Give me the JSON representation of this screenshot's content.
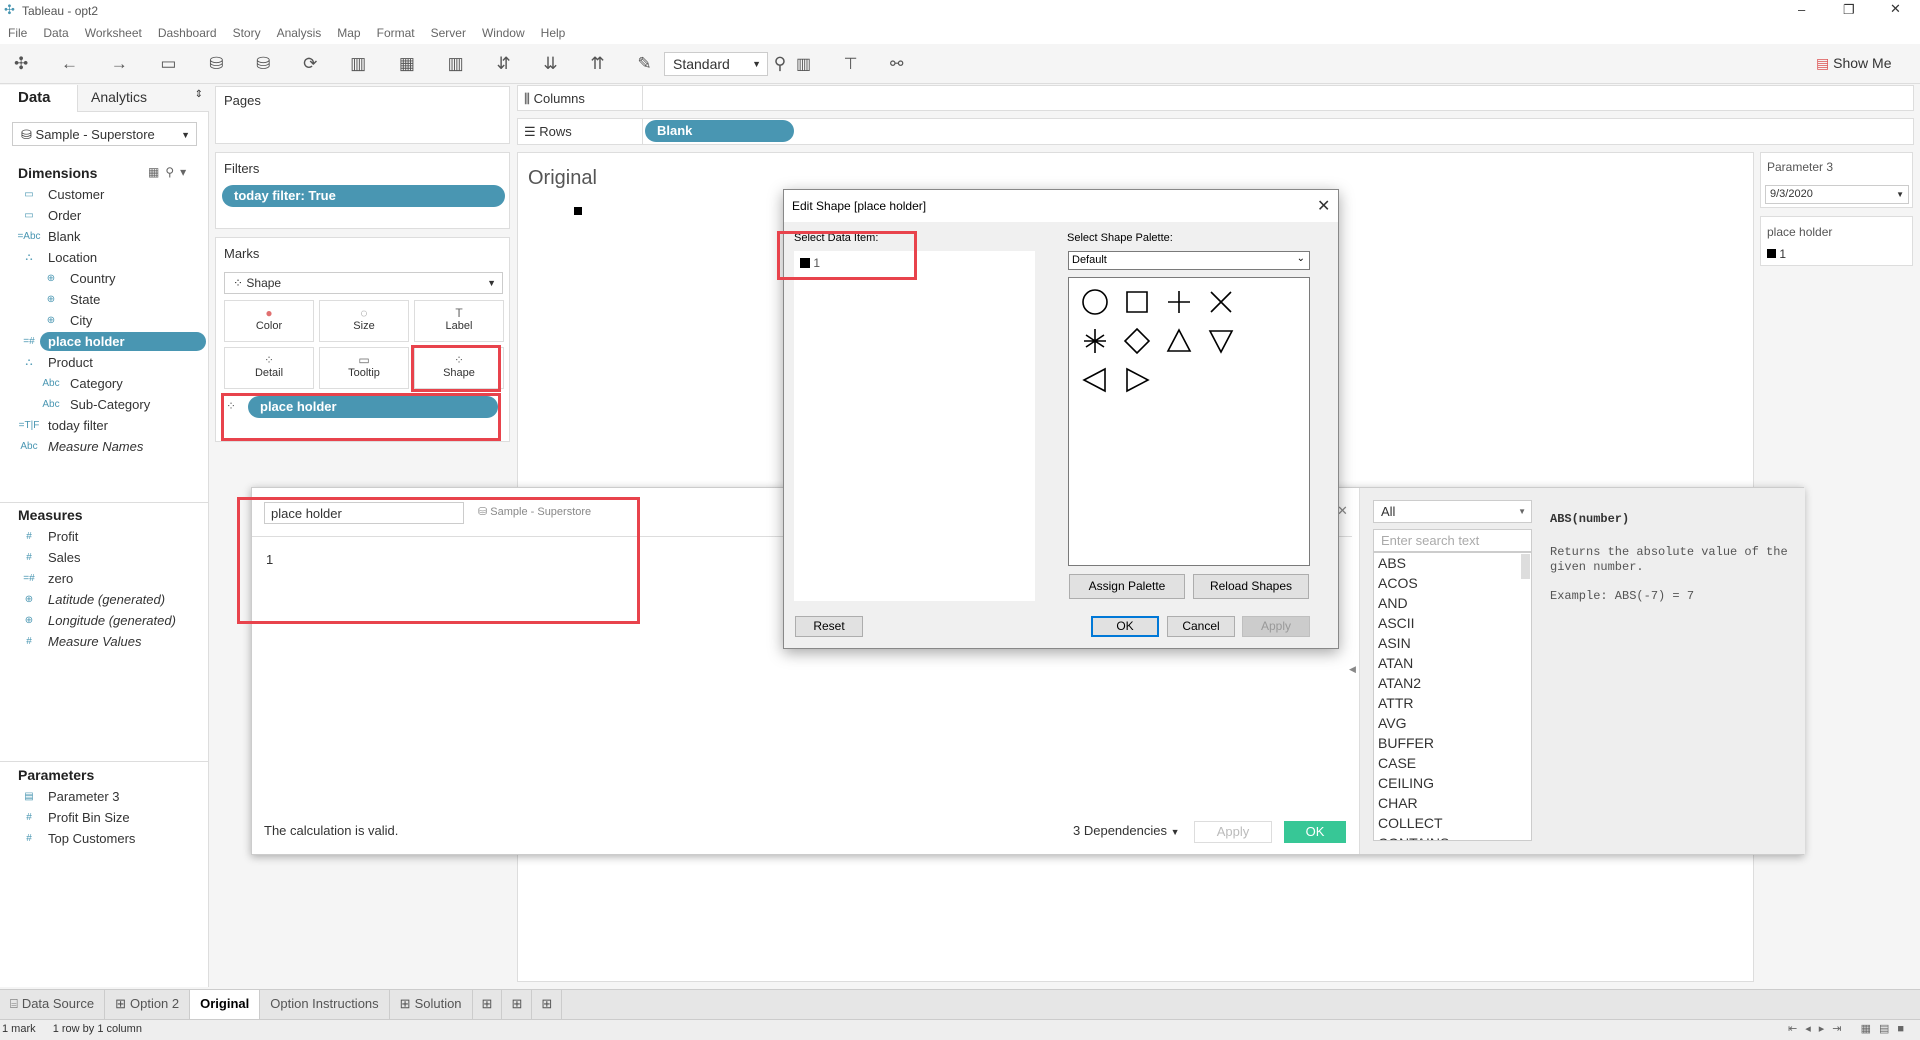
{
  "window": {
    "title": "Tableau - opt2"
  },
  "menu": [
    "File",
    "Data",
    "Worksheet",
    "Dashboard",
    "Story",
    "Analysis",
    "Map",
    "Format",
    "Server",
    "Window",
    "Help"
  ],
  "toolbar": {
    "fit": "Standard",
    "show_me": "Show Me"
  },
  "left": {
    "tabs": [
      "Data",
      "Analytics"
    ],
    "datasource": "Sample - Superstore",
    "dimensions_label": "Dimensions",
    "dimensions": [
      {
        "t": "Customer",
        "i": "▭",
        "l": 0
      },
      {
        "t": "Order",
        "i": "▭",
        "l": 0
      },
      {
        "t": "Blank",
        "i": "=Abc",
        "l": 0
      },
      {
        "t": "Location",
        "i": "⛬",
        "l": 0
      },
      {
        "t": "Country",
        "i": "⊕",
        "l": 1
      },
      {
        "t": "State",
        "i": "⊕",
        "l": 1
      },
      {
        "t": "City",
        "i": "⊕",
        "l": 1
      },
      {
        "t": "place holder",
        "i": "=#",
        "l": 0,
        "sel": true
      },
      {
        "t": "Product",
        "i": "⛬",
        "l": 0
      },
      {
        "t": "Category",
        "i": "Abc",
        "l": 1
      },
      {
        "t": "Sub-Category",
        "i": "Abc",
        "l": 1
      },
      {
        "t": "today filter",
        "i": "=T|F",
        "l": 0
      },
      {
        "t": "Measure Names",
        "i": "Abc",
        "l": 0,
        "it": true
      }
    ],
    "measures_label": "Measures",
    "measures": [
      {
        "t": "Profit",
        "i": "#"
      },
      {
        "t": "Sales",
        "i": "#"
      },
      {
        "t": "zero",
        "i": "=#"
      },
      {
        "t": "Latitude (generated)",
        "i": "⊕",
        "it": true
      },
      {
        "t": "Longitude (generated)",
        "i": "⊕",
        "it": true
      },
      {
        "t": "Measure Values",
        "i": "#",
        "it": true
      }
    ],
    "parameters_label": "Parameters",
    "parameters": [
      {
        "t": "Parameter 3",
        "i": "▤"
      },
      {
        "t": "Profit Bin Size",
        "i": "#"
      },
      {
        "t": "Top Customers",
        "i": "#"
      }
    ]
  },
  "shelves": {
    "pages": "Pages",
    "filters": "Filters",
    "filter_pill": "today filter: True",
    "marks": "Marks",
    "mark_type": "Shape",
    "mark_buttons": [
      "Color",
      "Size",
      "Label",
      "Detail",
      "Tooltip",
      "Shape"
    ],
    "marks_pill": "place holder",
    "columns": "Columns",
    "rows": "Rows",
    "rows_pill": "Blank"
  },
  "view": {
    "title": "Original"
  },
  "cards": {
    "param_title": "Parameter 3",
    "param_value": "9/3/2020",
    "legend_title": "place holder",
    "legend_item": "1"
  },
  "calc": {
    "name": "place holder",
    "datasource": "Sample - Superstore",
    "formula": "1",
    "status": "The calculation is valid.",
    "dependencies": "3 Dependencies",
    "apply": "Apply",
    "ok": "OK",
    "func_filter": "All",
    "search_placeholder": "Enter search text",
    "functions": [
      "ABS",
      "ACOS",
      "AND",
      "ASCII",
      "ASIN",
      "ATAN",
      "ATAN2",
      "ATTR",
      "AVG",
      "BUFFER",
      "CASE",
      "CEILING",
      "CHAR",
      "COLLECT",
      "CONTAINS"
    ],
    "help_sig": "ABS(number)",
    "help_desc": "Returns the absolute value of the given number.",
    "help_example": "Example: ABS(-7) = 7"
  },
  "dialog": {
    "title": "Edit Shape [place holder]",
    "select_item": "Select Data Item:",
    "item": "1",
    "select_palette": "Select Shape Palette:",
    "palette": "Default",
    "shapes": [
      "circle",
      "square",
      "plus",
      "cross",
      "asterisk",
      "diamond",
      "triangle-up",
      "triangle-down",
      "triangle-left",
      "triangle-right"
    ],
    "assign": "Assign Palette",
    "reload": "Reload Shapes",
    "reset": "Reset",
    "ok": "OK",
    "cancel": "Cancel",
    "apply": "Apply"
  },
  "tabs": [
    {
      "t": "Data Source",
      "i": "⌸"
    },
    {
      "t": "Option 2",
      "i": "⊞"
    },
    {
      "t": "Original",
      "active": true
    },
    {
      "t": "Option Instructions"
    },
    {
      "t": "Solution",
      "i": "⊞"
    }
  ],
  "status": {
    "marks": "1 mark",
    "rows": "1 row by 1 column"
  }
}
